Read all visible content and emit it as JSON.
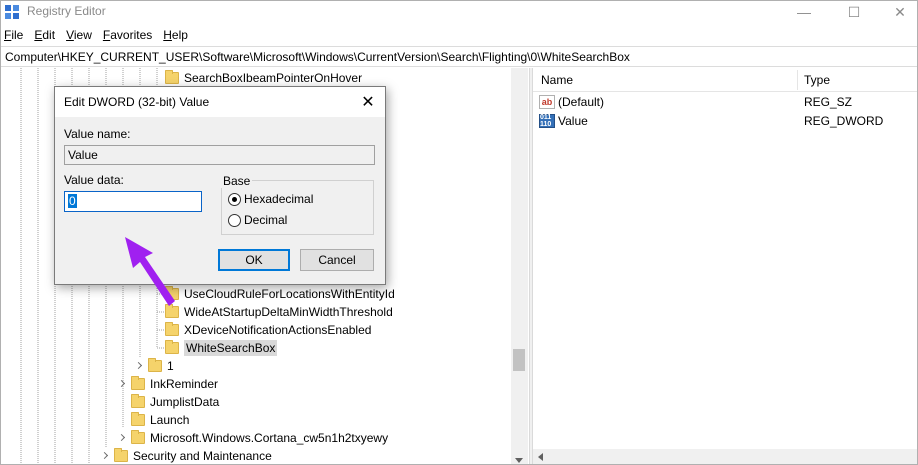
{
  "window": {
    "title": "Registry Editor",
    "controls": {
      "minimize": "—",
      "maximize": "☐",
      "close": "✕"
    }
  },
  "menu": {
    "items": [
      {
        "underline": "F",
        "rest": "ile"
      },
      {
        "underline": "E",
        "rest": "dit"
      },
      {
        "underline": "V",
        "rest": "iew"
      },
      {
        "underline": "F",
        "rest": "avorites"
      },
      {
        "underline": "H",
        "rest": "elp"
      }
    ]
  },
  "address": "Computer\\HKEY_CURRENT_USER\\Software\\Microsoft\\Windows\\CurrentVersion\\Search\\Flighting\\0\\WhiteSearchBox",
  "tree": {
    "items": [
      {
        "label": "SearchBoxIbeamPointerOnHover",
        "expandable": false,
        "selected": false
      },
      {
        "label": "UseCloudRuleForLocationsWithEntityId",
        "expandable": false,
        "selected": false
      },
      {
        "label": "WideAtStartupDeltaMinWidthThreshold",
        "expandable": false,
        "selected": false
      },
      {
        "label": "XDeviceNotificationActionsEnabled",
        "expandable": false,
        "selected": false
      },
      {
        "label": "WhiteSearchBox",
        "expandable": false,
        "selected": true
      },
      {
        "label": "1",
        "expandable": true,
        "selected": false
      },
      {
        "label": "InkReminder",
        "expandable": true,
        "selected": false
      },
      {
        "label": "JumplistData",
        "expandable": false,
        "selected": false
      },
      {
        "label": "Launch",
        "expandable": false,
        "selected": false
      },
      {
        "label": "Microsoft.Windows.Cortana_cw5n1h2txyewy",
        "expandable": true,
        "selected": false
      },
      {
        "label": "Security and Maintenance",
        "expandable": true,
        "selected": false
      }
    ]
  },
  "list": {
    "headers": {
      "name": "Name",
      "type": "Type"
    },
    "rows": [
      {
        "icon": "string-value-icon",
        "glyph": "ab",
        "name": "(Default)",
        "type": "REG_SZ"
      },
      {
        "icon": "dword-value-icon",
        "glyph": "011 110",
        "name": "Value",
        "type": "REG_DWORD"
      }
    ]
  },
  "dialog": {
    "title": "Edit DWORD (32-bit) Value",
    "close": "✕",
    "value_name_label": "Value name:",
    "value_name": "Value",
    "value_data_label": "Value data:",
    "value_data": "0",
    "base_label": "Base",
    "hex_label": "Hexadecimal",
    "dec_label": "Decimal",
    "selected_base": "hexadecimal",
    "ok": "OK",
    "cancel": "Cancel"
  },
  "colors": {
    "selection": "#0078d7",
    "annotation_arrow": "#a020f0",
    "folder": "#f5d36b"
  }
}
